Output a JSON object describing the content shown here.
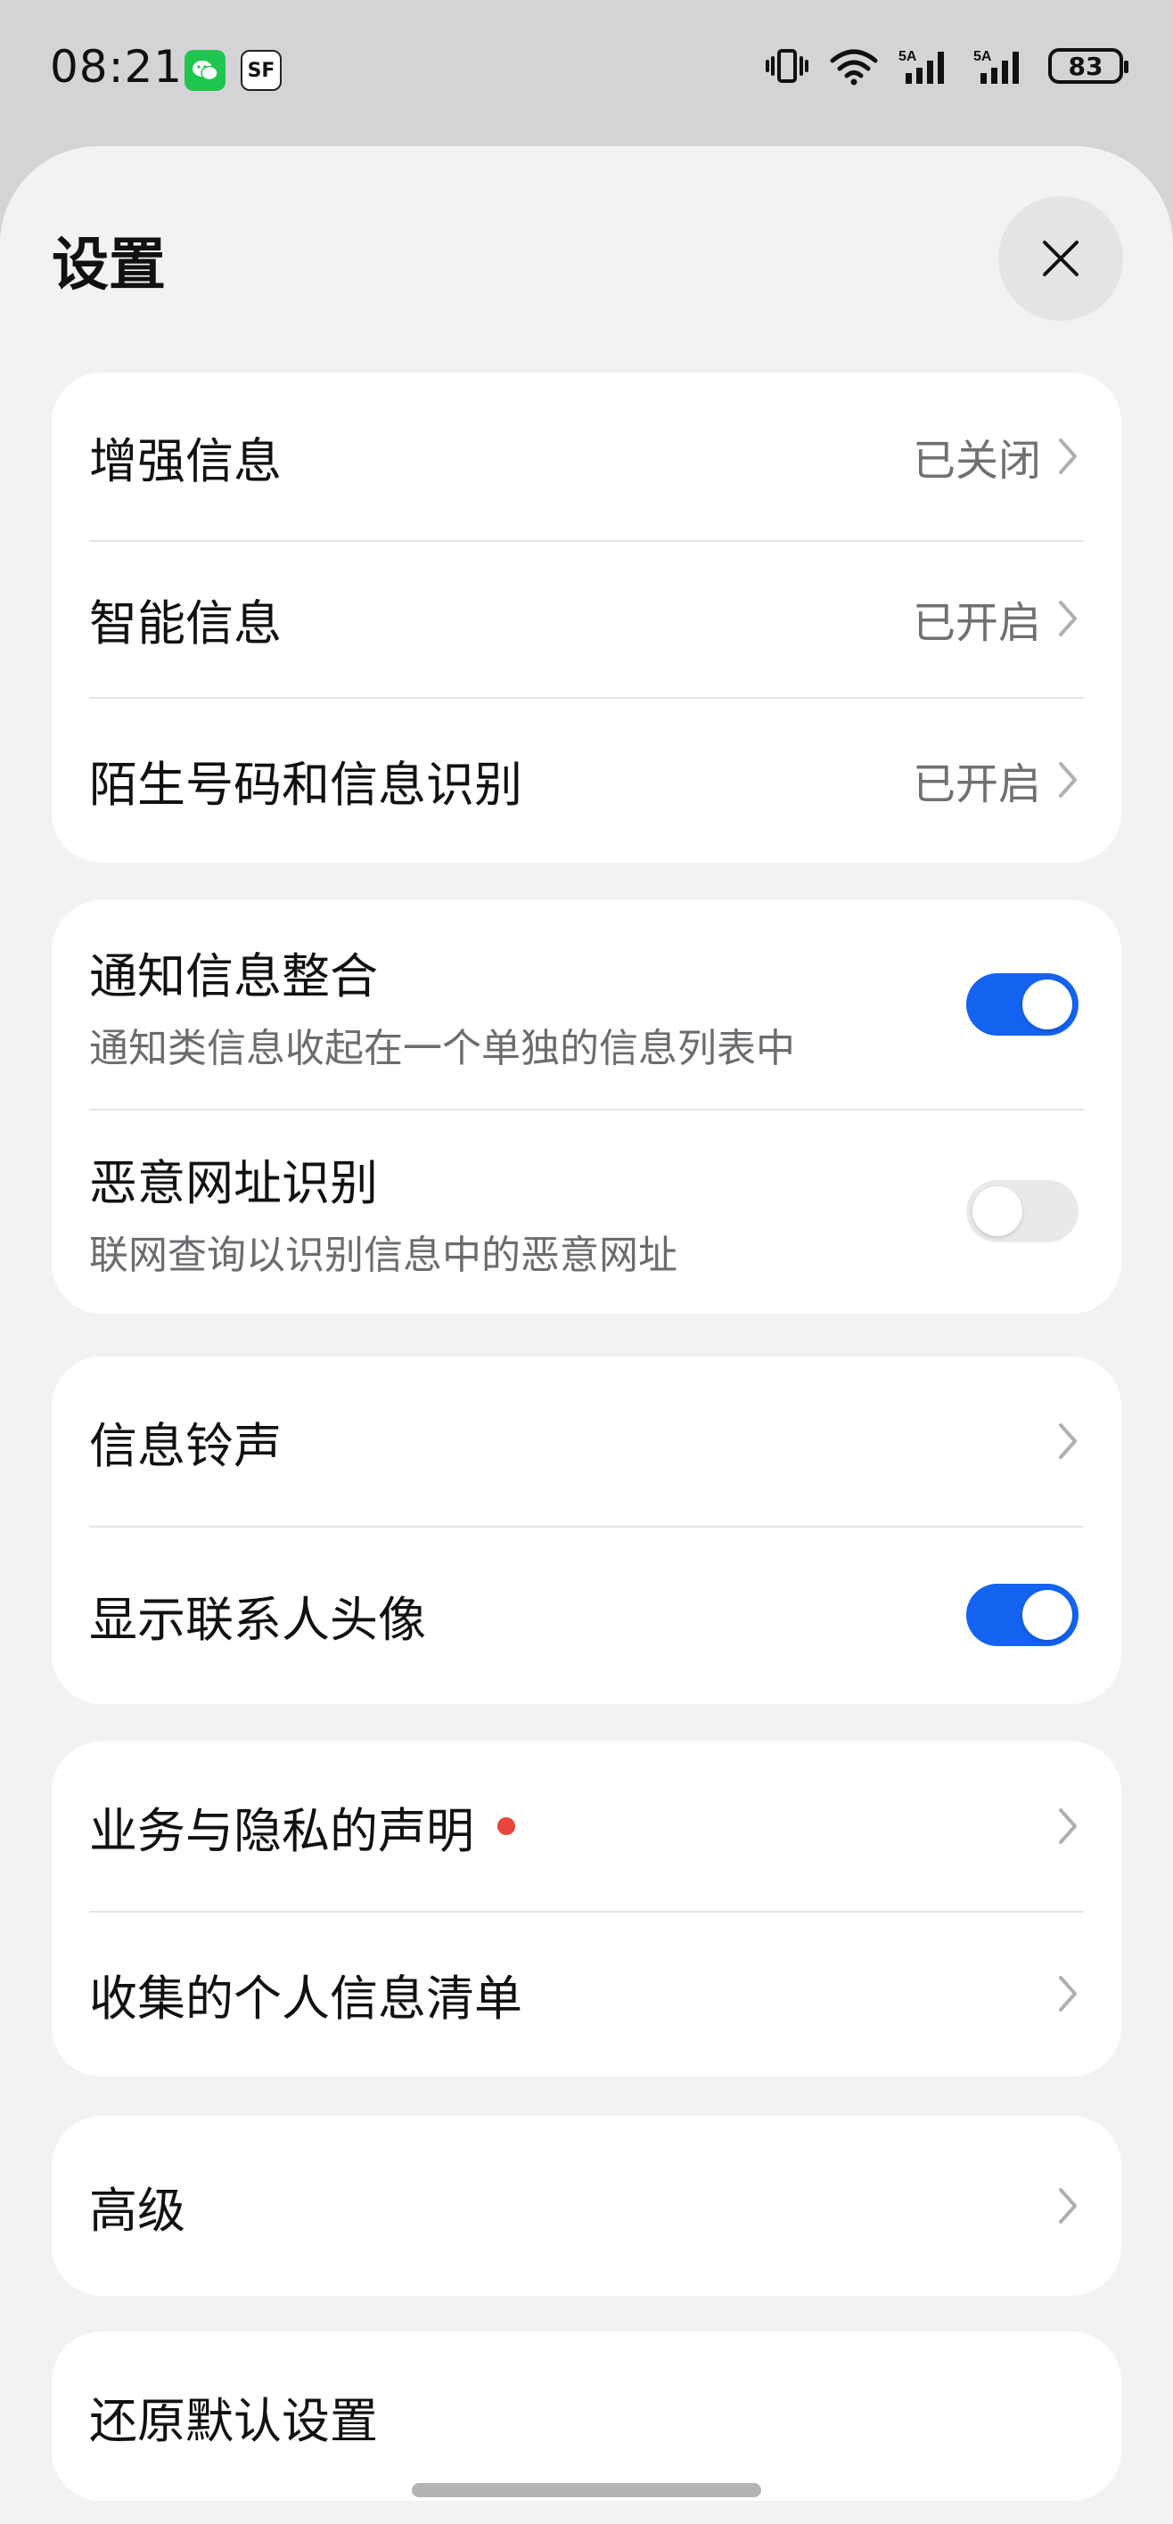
{
  "status_bar": {
    "time": "08:21",
    "sf_label": "SF",
    "battery": "83"
  },
  "header": {
    "title": "设置"
  },
  "group1": [
    {
      "label": "增强信息",
      "value": "已关闭"
    },
    {
      "label": "智能信息",
      "value": "已开启"
    },
    {
      "label": "陌生号码和信息识别",
      "value": "已开启"
    }
  ],
  "group2": [
    {
      "label": "通知信息整合",
      "sub": "通知类信息收起在一个单独的信息列表中",
      "toggle": "on"
    },
    {
      "label": "恶意网址识别",
      "sub": "联网查询以识别信息中的恶意网址",
      "toggle": "off"
    }
  ],
  "group3": [
    {
      "label": "信息铃声"
    },
    {
      "label": "显示联系人头像",
      "toggle": "on"
    }
  ],
  "group4": [
    {
      "label": "业务与隐私的声明",
      "badge": "red-dot"
    },
    {
      "label": "收集的个人信息清单"
    }
  ],
  "group5": [
    {
      "label": "高级"
    }
  ],
  "group6": [
    {
      "label": "还原默认设置"
    }
  ],
  "colors": {
    "accent": "#1462f0",
    "toggle_off": "#e9e9eb",
    "badge": "#e8453c",
    "background": "#f1f2f4"
  }
}
